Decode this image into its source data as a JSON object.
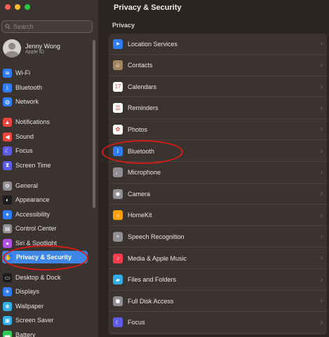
{
  "search": {
    "placeholder": "Search"
  },
  "user": {
    "name": "Jenny Wong",
    "subtitle": "Apple ID"
  },
  "sidebar": {
    "items": [
      {
        "label": "Wi-Fi",
        "icon": "wifi-icon",
        "color": "#2e7cf6"
      },
      {
        "label": "Bluetooth",
        "icon": "bluetooth-icon",
        "color": "#2e7cf6"
      },
      {
        "label": "Network",
        "icon": "globe-icon",
        "color": "#2e7cf6"
      },
      {
        "label": "Notifications",
        "icon": "bell-icon",
        "color": "#e8453c"
      },
      {
        "label": "Sound",
        "icon": "speaker-icon",
        "color": "#e8453c"
      },
      {
        "label": "Focus",
        "icon": "moon-icon",
        "color": "#5e5ce6"
      },
      {
        "label": "Screen Time",
        "icon": "hourglass-icon",
        "color": "#5e5ce6"
      },
      {
        "label": "General",
        "icon": "gear-icon",
        "color": "#8e8e93"
      },
      {
        "label": "Appearance",
        "icon": "appearance-icon",
        "color": "#1c1c1e"
      },
      {
        "label": "Accessibility",
        "icon": "accessibility-icon",
        "color": "#2e7cf6"
      },
      {
        "label": "Control Center",
        "icon": "control-center-icon",
        "color": "#8e8e93"
      },
      {
        "label": "Siri & Spotlight",
        "icon": "siri-icon",
        "color": "#af52de"
      },
      {
        "label": "Privacy & Security",
        "icon": "hand-icon",
        "color": "#2e7cf6",
        "selected": true
      },
      {
        "label": "Desktop & Dock",
        "icon": "dock-icon",
        "color": "#1c1c1e"
      },
      {
        "label": "Displays",
        "icon": "sun-icon",
        "color": "#2e7cf6"
      },
      {
        "label": "Wallpaper",
        "icon": "wallpaper-icon",
        "color": "#32ade6"
      },
      {
        "label": "Screen Saver",
        "icon": "screen-saver-icon",
        "color": "#32ade6"
      },
      {
        "label": "Battery",
        "icon": "battery-icon",
        "color": "#34c759"
      }
    ]
  },
  "main": {
    "title": "Privacy & Security",
    "section": "Privacy",
    "rows": [
      {
        "label": "Location Services",
        "icon": "location-arrow-icon",
        "color": "#2e7cf6"
      },
      {
        "label": "Contacts",
        "icon": "contacts-icon",
        "color": "#a2845e"
      },
      {
        "label": "Calendars",
        "icon": "calendar-icon",
        "color": "#ffffff",
        "glyph": "17"
      },
      {
        "label": "Reminders",
        "icon": "reminders-icon",
        "color": "#ffffff"
      },
      {
        "label": "Photos",
        "icon": "photos-icon",
        "color": "#ffffff"
      },
      {
        "label": "Bluetooth",
        "icon": "bluetooth-icon",
        "color": "#2e7cf6"
      },
      {
        "label": "Microphone",
        "icon": "microphone-icon",
        "color": "#8e8e93"
      },
      {
        "label": "Camera",
        "icon": "camera-icon",
        "color": "#8e8e93"
      },
      {
        "label": "HomeKit",
        "icon": "home-icon",
        "color": "#ff9f0a"
      },
      {
        "label": "Speech Recognition",
        "icon": "waveform-icon",
        "color": "#8e8e93"
      },
      {
        "label": "Media & Apple Music",
        "icon": "music-note-icon",
        "color": "#fa3c4c"
      },
      {
        "label": "Files and Folders",
        "icon": "folder-icon",
        "color": "#32ade6"
      },
      {
        "label": "Full Disk Access",
        "icon": "disk-icon",
        "color": "#8e8e93"
      },
      {
        "label": "Focus",
        "icon": "moon-icon",
        "color": "#5e5ce6"
      }
    ]
  }
}
